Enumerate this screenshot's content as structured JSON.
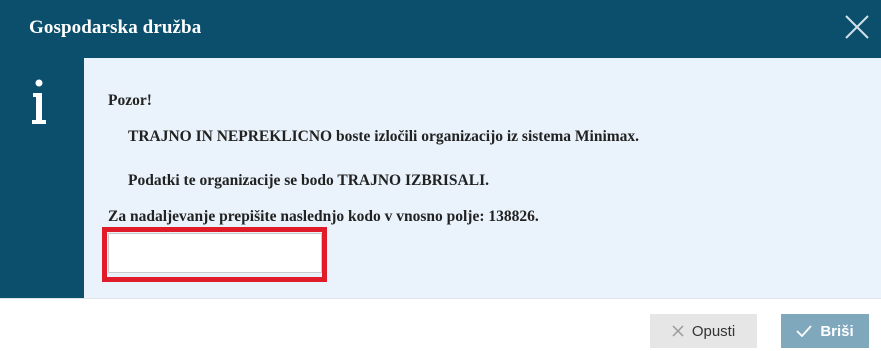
{
  "dialog": {
    "title": "Gospodarska družba",
    "close_icon": "close-icon",
    "info_icon": "info-icon",
    "colors": {
      "header": "#0b4f6c",
      "content_bg": "#eaf3fb",
      "highlight": "#e01b2a"
    }
  },
  "message": {
    "warning": "Pozor!",
    "line1": "TRAJNO IN NEPREKLICNO boste izločili organizacijo iz sistema Minimax.",
    "line2": "Podatki te organizacije se bodo TRAJNO IZBRISALI.",
    "instruction": "Za nadaljevanje prepišite naslednjo kodo v vnosno polje: 138826."
  },
  "input": {
    "value": "",
    "placeholder": ""
  },
  "buttons": {
    "cancel_label": "Opusti",
    "cancel_icon": "x-icon",
    "delete_label": "Briši",
    "delete_icon": "check-icon"
  }
}
